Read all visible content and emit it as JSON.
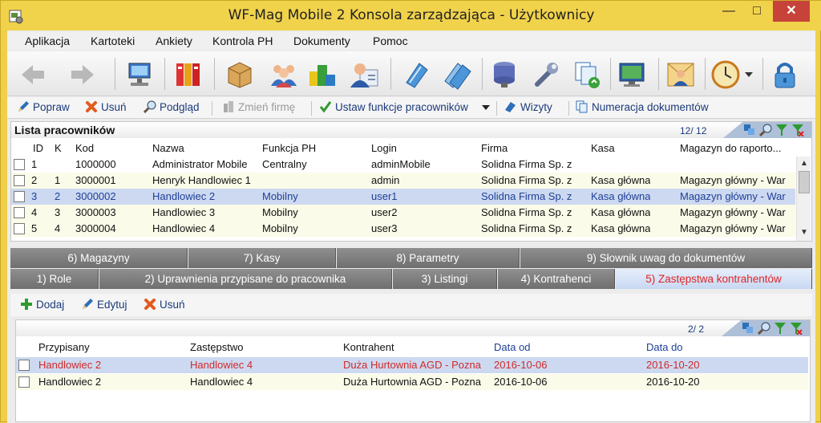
{
  "window": {
    "title": "WF-Mag Mobile 2 Konsola zarządzająca - Użytkownicy",
    "minimize": "—",
    "maximize": "□",
    "close": "✕"
  },
  "menu": [
    "Aplikacja",
    "Kartoteki",
    "Ankiety",
    "Kontrola PH",
    "Dokumenty",
    "Pomoc"
  ],
  "toolbar_icons": [
    "back-arrow-icon",
    "forward-arrow-icon",
    "computer-network-icon",
    "books-icon",
    "package-icon",
    "group-people-icon",
    "blocks-icon",
    "user-card-icon",
    "document-blue-icon",
    "documents-stack-icon",
    "server-icon",
    "wrench-icon",
    "copy-refresh-icon",
    "monitor-icon",
    "contact-card-icon",
    "clock-icon",
    "lock-icon"
  ],
  "actions": {
    "popraw": "Popraw",
    "usun": "Usuń",
    "podglad": "Podgląd",
    "zmien_firme": "Zmień firmę",
    "ustaw_funkcje": "Ustaw funkcje pracowników",
    "wizyty": "Wizyty",
    "numeracja": "Numeracja dokumentów"
  },
  "employees": {
    "title": "Lista pracowników",
    "count": "12/ 12",
    "columns": [
      "ID",
      "K",
      "Kod",
      "Nazwa",
      "Funkcja PH",
      "Login",
      "Firma",
      "Kasa",
      "Magazyn do raporto..."
    ],
    "rows": [
      {
        "id": "1",
        "k": "",
        "kod": "1000000",
        "nazwa": "Administrator Mobile",
        "funkcja": "Centralny",
        "login": "adminMobile",
        "firma": "Solidna Firma Sp. z",
        "kasa": "",
        "magazyn": ""
      },
      {
        "id": "2",
        "k": "1",
        "kod": "3000001",
        "nazwa": "Henryk Handlowiec 1",
        "funkcja": "",
        "login": "admin",
        "firma": "Solidna Firma Sp. z",
        "kasa": "Kasa główna",
        "magazyn": "Magazyn główny - War"
      },
      {
        "id": "3",
        "k": "2",
        "kod": "3000002",
        "nazwa": "Handlowiec 2",
        "funkcja": "Mobilny",
        "login": "user1",
        "firma": "Solidna Firma Sp. z",
        "kasa": "Kasa główna",
        "magazyn": "Magazyn główny - War"
      },
      {
        "id": "4",
        "k": "3",
        "kod": "3000003",
        "nazwa": "Handlowiec 3",
        "funkcja": "Mobilny",
        "login": "user2",
        "firma": "Solidna Firma Sp. z",
        "kasa": "Kasa główna",
        "magazyn": "Magazyn główny - War"
      },
      {
        "id": "5",
        "k": "4",
        "kod": "3000004",
        "nazwa": "Handlowiec 4",
        "funkcja": "Mobilny",
        "login": "user3",
        "firma": "Solidna Firma Sp. z",
        "kasa": "Kasa główna",
        "magazyn": "Magazyn główny - War"
      }
    ]
  },
  "tabs_row1": [
    "6) Magazyny",
    "7) Kasy",
    "8) Parametry",
    "9) Słownik uwag do dokumentów"
  ],
  "tabs_row2": [
    "1) Role",
    "2) Uprawnienia przypisane do pracownika",
    "3) Listingi",
    "4) Kontrahenci",
    "5) Zastępstwa kontrahentów"
  ],
  "sub_actions": {
    "dodaj": "Dodaj",
    "edytuj": "Edytuj",
    "usun": "Usuń"
  },
  "substitutions": {
    "count": "2/ 2",
    "columns": [
      "Przypisany",
      "Zastępstwo",
      "Kontrahent",
      "Data od",
      "Data do"
    ],
    "rows": [
      {
        "przypisany": "Handlowiec 2",
        "zastepstwo": "Handlowiec 4",
        "kontrahent": "Duża Hurtownia AGD - Pozna",
        "od": "2016-10-06",
        "do": "2016-10-20"
      },
      {
        "przypisany": "Handlowiec 2",
        "zastepstwo": "Handlowiec 4",
        "kontrahent": "Duża Hurtownia AGD - Pozna",
        "od": "2016-10-06",
        "do": "2016-10-20"
      }
    ]
  },
  "colors": {
    "titlebar": "#f1d24b",
    "close": "#c7433a",
    "selected_row": "#cdd9f0",
    "active_tab_text": "#e02424",
    "tab_bg": "#7f7f7f"
  }
}
